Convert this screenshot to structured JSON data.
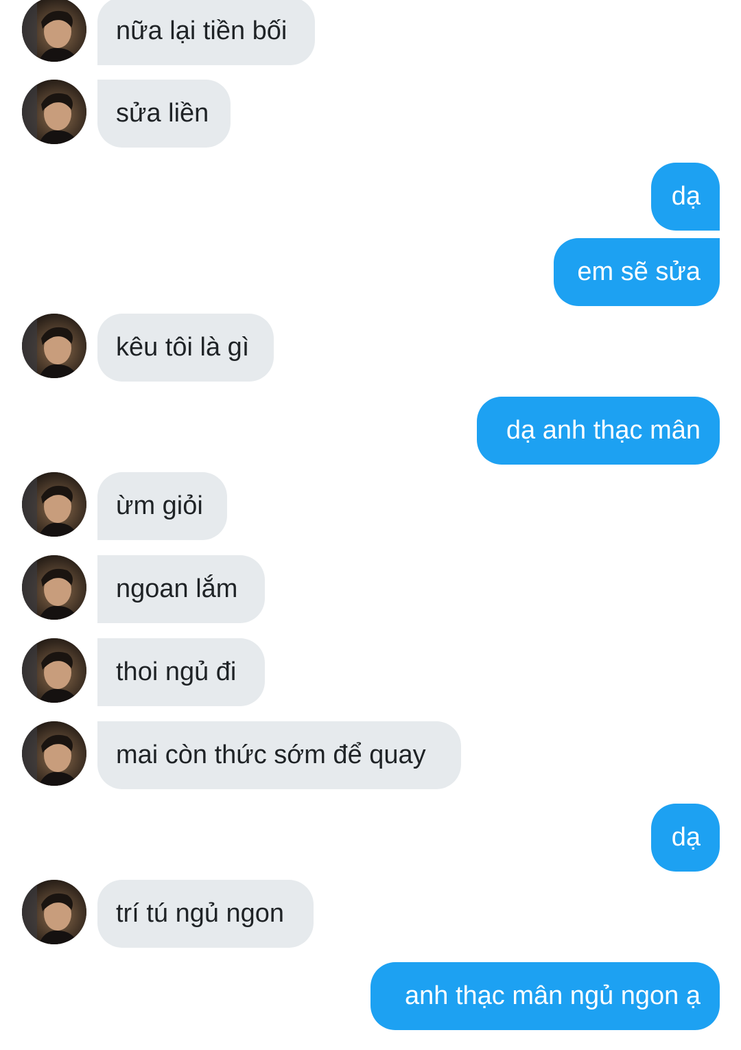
{
  "conversation": {
    "messages": [
      {
        "direction": "incoming",
        "text": "nữa lại tiền bối",
        "has_avatar": true
      },
      {
        "direction": "incoming",
        "text": "sửa liền",
        "has_avatar": true
      },
      {
        "direction": "outgoing",
        "text": "dạ"
      },
      {
        "direction": "outgoing",
        "text": "em sẽ sửa"
      },
      {
        "direction": "incoming",
        "text": "kêu tôi là gì",
        "has_avatar": true
      },
      {
        "direction": "outgoing",
        "text": "dạ anh thạc mân"
      },
      {
        "direction": "incoming",
        "text": "ừm giỏi",
        "has_avatar": true
      },
      {
        "direction": "incoming",
        "text": "ngoan lắm",
        "has_avatar": true
      },
      {
        "direction": "incoming",
        "text": "thoi ngủ đi",
        "has_avatar": true
      },
      {
        "direction": "incoming",
        "text": "mai còn thức sớm để quay",
        "has_avatar": true
      },
      {
        "direction": "outgoing",
        "text": "dạ"
      },
      {
        "direction": "incoming",
        "text": "trí tú ngủ ngon",
        "has_avatar": true
      },
      {
        "direction": "outgoing",
        "text": "anh thạc mân ngủ ngon ạ"
      }
    ]
  },
  "colors": {
    "incoming_bubble": "#e6eaed",
    "incoming_text": "#1f2326",
    "outgoing_bubble": "#1da1f2",
    "outgoing_text": "#ffffff",
    "background": "#ffffff"
  },
  "icons": {
    "incoming_avatar": "profile-photo-avatar-icon"
  }
}
